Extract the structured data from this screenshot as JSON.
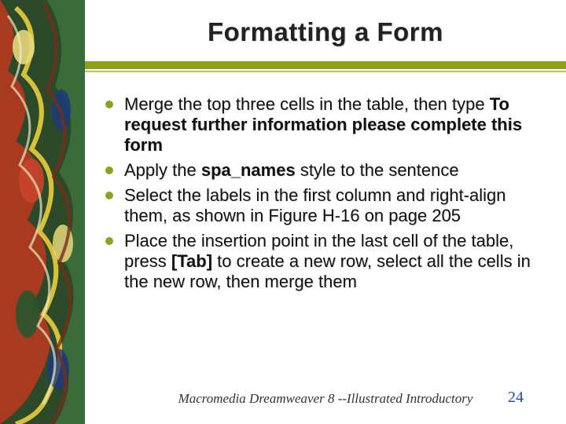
{
  "title": "Formatting a Form",
  "bullets": [
    {
      "pre": "Merge the top three cells in the table, then type ",
      "bold": "To request further information please complete this form",
      "post": ""
    },
    {
      "pre": "Apply the ",
      "bold": "spa_names",
      "post": " style to the sentence"
    },
    {
      "pre": "Select the labels in the first column and right-align them, as shown in Figure H-16 on page 205",
      "bold": "",
      "post": ""
    },
    {
      "pre": "Place the insertion point in the last cell of the table, press ",
      "bold": "[Tab]",
      "post": " to create a new row, select all the cells in the new row, then merge them"
    }
  ],
  "footer": "Macromedia Dreamweaver 8 --Illustrated Introductory",
  "page_number": "24"
}
